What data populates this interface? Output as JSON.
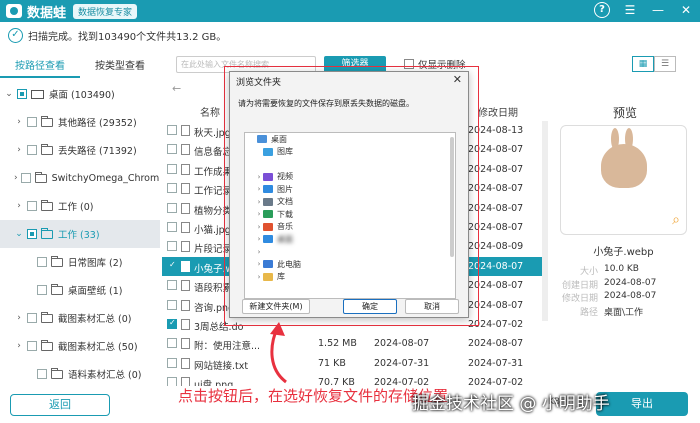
{
  "colors": {
    "accent": "#1a9bb2",
    "highlight": "#e8313f"
  },
  "app": {
    "brand": "数据蛙",
    "subtitle": "数据恢复专家"
  },
  "titlebar_icons": [
    "help-icon",
    "menu-icon",
    "minimize-icon",
    "close-icon"
  ],
  "status": {
    "text": "扫描完成。找到103490个文件共13.2 GB。"
  },
  "left_tabs": [
    {
      "label": "按路径查看",
      "active": true
    },
    {
      "label": "按类型查看",
      "active": false
    }
  ],
  "tree": [
    {
      "label": "桌面 (103490)"
    },
    {
      "label": "其他路径 (29352)"
    },
    {
      "label": "丢失路径 (71392)"
    },
    {
      "label": "SwitchyOmega_Chromium"
    },
    {
      "label": "工作 (0)"
    },
    {
      "label": "工作 (33)"
    },
    {
      "label": "日常图库 (2)"
    },
    {
      "label": "桌面壁纸 (1)"
    },
    {
      "label": "截图素材汇总 (0)"
    },
    {
      "label": "截图素材汇总 (50)"
    },
    {
      "label": "语料素材汇总 (0)"
    }
  ],
  "back_button": "返回",
  "filter": {
    "placeholder": "在此处输入文件名称搜索",
    "button": "筛选器",
    "only_deleted": "仅显示删除"
  },
  "columns": {
    "name": "名称",
    "modified": "修改日期"
  },
  "files": [
    {
      "name": "秋天.jpg",
      "size": "",
      "created": "",
      "modified": "2024-08-13",
      "checked": false,
      "selected": false
    },
    {
      "name": "信息备忘.t",
      "size": "",
      "created": "",
      "modified": "2024-08-07",
      "checked": false,
      "selected": false
    },
    {
      "name": "工作成果分",
      "size": "",
      "created": "",
      "modified": "2024-08-07",
      "checked": false,
      "selected": false
    },
    {
      "name": "工作记录表",
      "size": "",
      "created": "",
      "modified": "2024-08-07",
      "checked": false,
      "selected": false
    },
    {
      "name": "植物分类.d",
      "size": "",
      "created": "",
      "modified": "2024-08-07",
      "checked": false,
      "selected": false
    },
    {
      "name": "小猫.jpg",
      "size": "",
      "created": "",
      "modified": "2024-08-07",
      "checked": false,
      "selected": false
    },
    {
      "name": "片段记录.d",
      "size": "",
      "created": "",
      "modified": "2024-08-09",
      "checked": false,
      "selected": false
    },
    {
      "name": "小兔子.web",
      "size": "",
      "created": "",
      "modified": "2024-08-07",
      "checked": true,
      "selected": true
    },
    {
      "name": "语段积累.d",
      "size": "",
      "created": "",
      "modified": "2024-08-07",
      "checked": false,
      "selected": false
    },
    {
      "name": "咨询.png",
      "size": "",
      "created": "",
      "modified": "2024-08-07",
      "checked": false,
      "selected": false
    },
    {
      "name": "3周总结.do",
      "size": "",
      "created": "",
      "modified": "2024-07-02",
      "checked": true,
      "selected": false
    },
    {
      "name": "附：使用注意...",
      "size": "1.52 MB",
      "created": "2024-08-07",
      "modified": "2024-08-07",
      "checked": false,
      "selected": false
    },
    {
      "name": "网站链接.txt",
      "size": "71 KB",
      "created": "2024-07-31",
      "modified": "2024-07-31",
      "checked": false,
      "selected": false
    },
    {
      "name": "ui盘.png",
      "size": "70.7 KB",
      "created": "2024-07-02",
      "modified": "2024-07-02",
      "checked": false,
      "selected": false
    }
  ],
  "preview": {
    "title": "预览",
    "file_name": "小兔子.webp",
    "meta": [
      {
        "k": "大小",
        "v": "10.0 KB"
      },
      {
        "k": "创建日期",
        "v": "2024-08-07"
      },
      {
        "k": "修改日期",
        "v": "2024-08-07"
      },
      {
        "k": "路径",
        "v": "桌面\\工作"
      }
    ]
  },
  "export_button": "导出",
  "dialog": {
    "title": "浏览文件夹",
    "message": "请为将需要恢复的文件保存到原丢失数据的磁盘。",
    "tree": [
      {
        "label": "桌面",
        "expander": "",
        "indent": 0,
        "color": "#4a90d9"
      },
      {
        "label": "图库",
        "expander": "",
        "indent": 1,
        "color": "#3aa0e0"
      },
      {
        "label": "",
        "expander": "",
        "indent": 1,
        "color": "#ffffff"
      },
      {
        "label": "视频",
        "expander": "›",
        "indent": 1,
        "color": "#7b4fd6"
      },
      {
        "label": "图片",
        "expander": "›",
        "indent": 1,
        "color": "#2f8be0"
      },
      {
        "label": "文档",
        "expander": "›",
        "indent": 1,
        "color": "#6a7a8a"
      },
      {
        "label": "下载",
        "expander": "›",
        "indent": 1,
        "color": "#2a9d5a"
      },
      {
        "label": "音乐",
        "expander": "›",
        "indent": 1,
        "color": "#e0522f"
      },
      {
        "label": "桌面",
        "expander": "›",
        "indent": 1,
        "color": "#2f8be0",
        "blurred": true
      },
      {
        "label": "",
        "expander": "›",
        "indent": 1,
        "color": "#ffffff"
      },
      {
        "label": "此电脑",
        "expander": "›",
        "indent": 1,
        "color": "#3a7bd5"
      },
      {
        "label": "库",
        "expander": "›",
        "indent": 1,
        "color": "#e8b84a"
      }
    ],
    "new_folder": "新建文件夹(M)",
    "ok": "确定",
    "cancel": "取消"
  },
  "annotation": {
    "instruction": "点击按钮后，在选好恢复文件的存储位置"
  },
  "watermark": "掘金技术社区 @ 小明助手",
  "footer_size": "KB"
}
